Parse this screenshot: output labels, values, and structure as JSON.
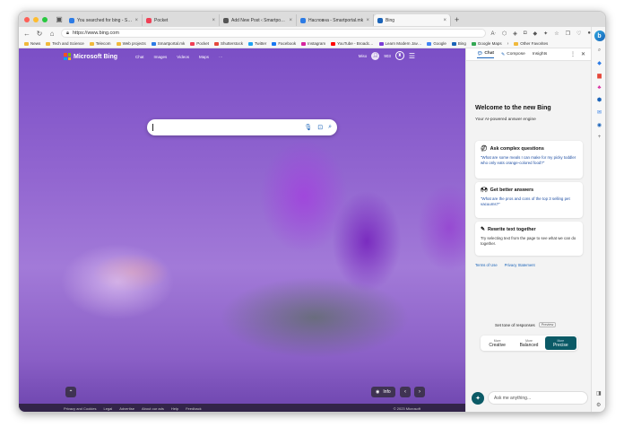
{
  "tabs": [
    {
      "label": "You searched for bing - Smar…",
      "color": "#2c7be5"
    },
    {
      "label": "Pocket",
      "color": "#ef4056"
    },
    {
      "label": "Add New Post ‹ Smartportal.m…",
      "color": "#555555"
    },
    {
      "label": "Нaсловна - Smartportal.mk",
      "color": "#2c7be5"
    },
    {
      "label": "Bing",
      "color": "#1a63b8",
      "active": true
    }
  ],
  "address": {
    "url": "https://www.bing.com"
  },
  "bookmarks": [
    {
      "label": "News",
      "color": "#f0b93b"
    },
    {
      "label": "Tech and Science",
      "color": "#f0b93b"
    },
    {
      "label": "Telecom",
      "color": "#f0b93b"
    },
    {
      "label": "Web projects",
      "color": "#f0b93b"
    },
    {
      "label": "Smartportal.mk",
      "color": "#2c7be5"
    },
    {
      "label": "Pocket",
      "color": "#ef4056"
    },
    {
      "label": "Shutterstock",
      "color": "#e5483b"
    },
    {
      "label": "Twitter",
      "color": "#1da1f2"
    },
    {
      "label": "Facebook",
      "color": "#1877f2"
    },
    {
      "label": "Instagram",
      "color": "#d6249f"
    },
    {
      "label": "YouTube - Broadc…",
      "color": "#ff0000"
    },
    {
      "label": "Learn Modern Jav…",
      "color": "#7a3cd6"
    },
    {
      "label": "Google",
      "color": "#4285f4"
    },
    {
      "label": "Bing",
      "color": "#1a63b8"
    },
    {
      "label": "Google Maps",
      "color": "#34a853"
    },
    {
      "label": "Other Favorites",
      "color": "#f0b93b"
    }
  ],
  "bing": {
    "brand": "Microsoft Bing",
    "nav": [
      "Chat",
      "Images",
      "Videos",
      "Maps",
      "···"
    ],
    "user": "Miso",
    "points": "903",
    "info": "Info"
  },
  "footer": {
    "links": [
      "Privacy and Cookies",
      "Legal",
      "Advertise",
      "About our ads",
      "Help",
      "Feedback"
    ],
    "copyright": "© 2023 Microsoft"
  },
  "sidebar": {
    "tabs": [
      "Chat",
      "Compose",
      "Insights"
    ],
    "welcome": "Welcome to the new Bing",
    "subtitle": "Your AI-powered answer engine",
    "cards": [
      {
        "emoji": "?",
        "title": "Ask complex questions",
        "body": "\"What are some meals I can make for my picky toddler who only eats orange-colored food?\""
      },
      {
        "emoji": "🙌",
        "title": "Get better answers",
        "body": "\"What are the pros and cons of the top 3 selling pet vacuums?\""
      },
      {
        "emoji": "✎",
        "title": "Rewrite text together",
        "body": "Try selecting text from the page to see what we can do together."
      }
    ],
    "links": [
      "Terms of Use",
      "Privacy Statement"
    ],
    "tone_title": "Set tone of responses",
    "tone_tag": "Preview",
    "tones": [
      {
        "more": "More",
        "label": "Creative"
      },
      {
        "more": "More",
        "label": "Balanced"
      },
      {
        "more": "More",
        "label": "Precise"
      }
    ],
    "ask_placeholder": "Ask me anything..."
  },
  "colors": {
    "accent": "#0b5a66",
    "link": "#1a63b8"
  }
}
